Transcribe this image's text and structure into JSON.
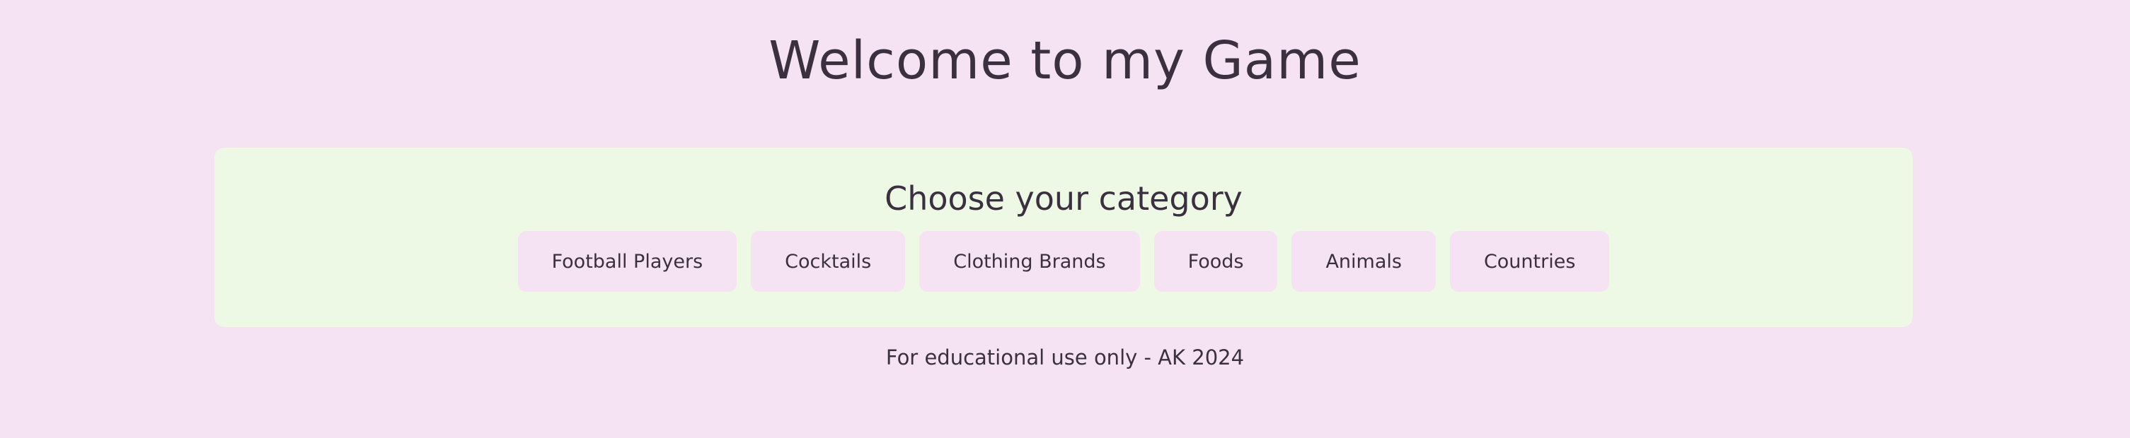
{
  "header": {
    "title": "Welcome to my Game"
  },
  "category_panel": {
    "heading": "Choose your category",
    "categories": [
      {
        "label": "Football Players"
      },
      {
        "label": "Cocktails"
      },
      {
        "label": "Clothing Brands"
      },
      {
        "label": "Foods"
      },
      {
        "label": "Animals"
      },
      {
        "label": "Countries"
      }
    ]
  },
  "footer": {
    "text": "For educational use only - AK 2024"
  },
  "colors": {
    "page_background": "#f5e3f3",
    "panel_background": "#edf8e5",
    "button_background": "#f5e3f3",
    "text": "#3a3040"
  }
}
